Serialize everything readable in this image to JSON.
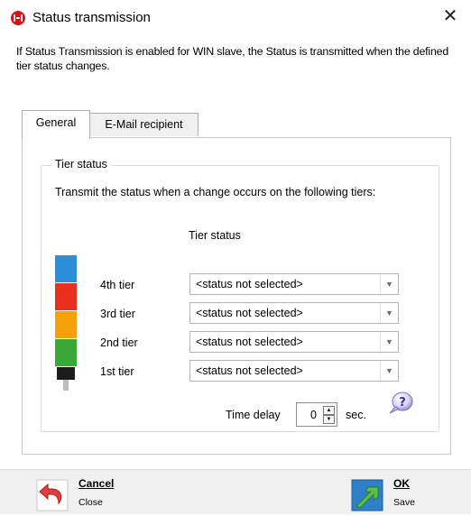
{
  "window": {
    "title": "Status transmission",
    "close_glyph": "✕"
  },
  "description": "If Status Transmission is enabled for WIN slave, the Status is transmitted when the defined tier status changes.",
  "tabs": [
    {
      "label": "General",
      "active": true
    },
    {
      "label": "E-Mail recipient",
      "active": false
    }
  ],
  "tier_group": {
    "legend": "Tier status",
    "instruction": "Transmit the status when a change occurs on the following tiers:",
    "column_header": "Tier status",
    "tiers": [
      {
        "label": "4th tier",
        "value": "<status not selected>",
        "color": "#2a8fd6"
      },
      {
        "label": "3rd tier",
        "value": "<status not selected>",
        "color": "#e8301e"
      },
      {
        "label": "2nd tier",
        "value": "<status not selected>",
        "color": "#f5a10c"
      },
      {
        "label": "1st tier",
        "value": "<status not selected>",
        "color": "#3aa837"
      }
    ],
    "time_delay_label": "Time delay",
    "time_delay_value": "0",
    "time_delay_unit": "sec."
  },
  "footer": {
    "cancel_label": "Cancel",
    "cancel_sub": "Close",
    "ok_label": "OK",
    "ok_sub": "Save"
  },
  "icons": {
    "app": "app-logo-icon",
    "help": "help-question-icon",
    "cancel": "undo-arrow-icon",
    "ok": "checkmark-arrow-icon"
  }
}
